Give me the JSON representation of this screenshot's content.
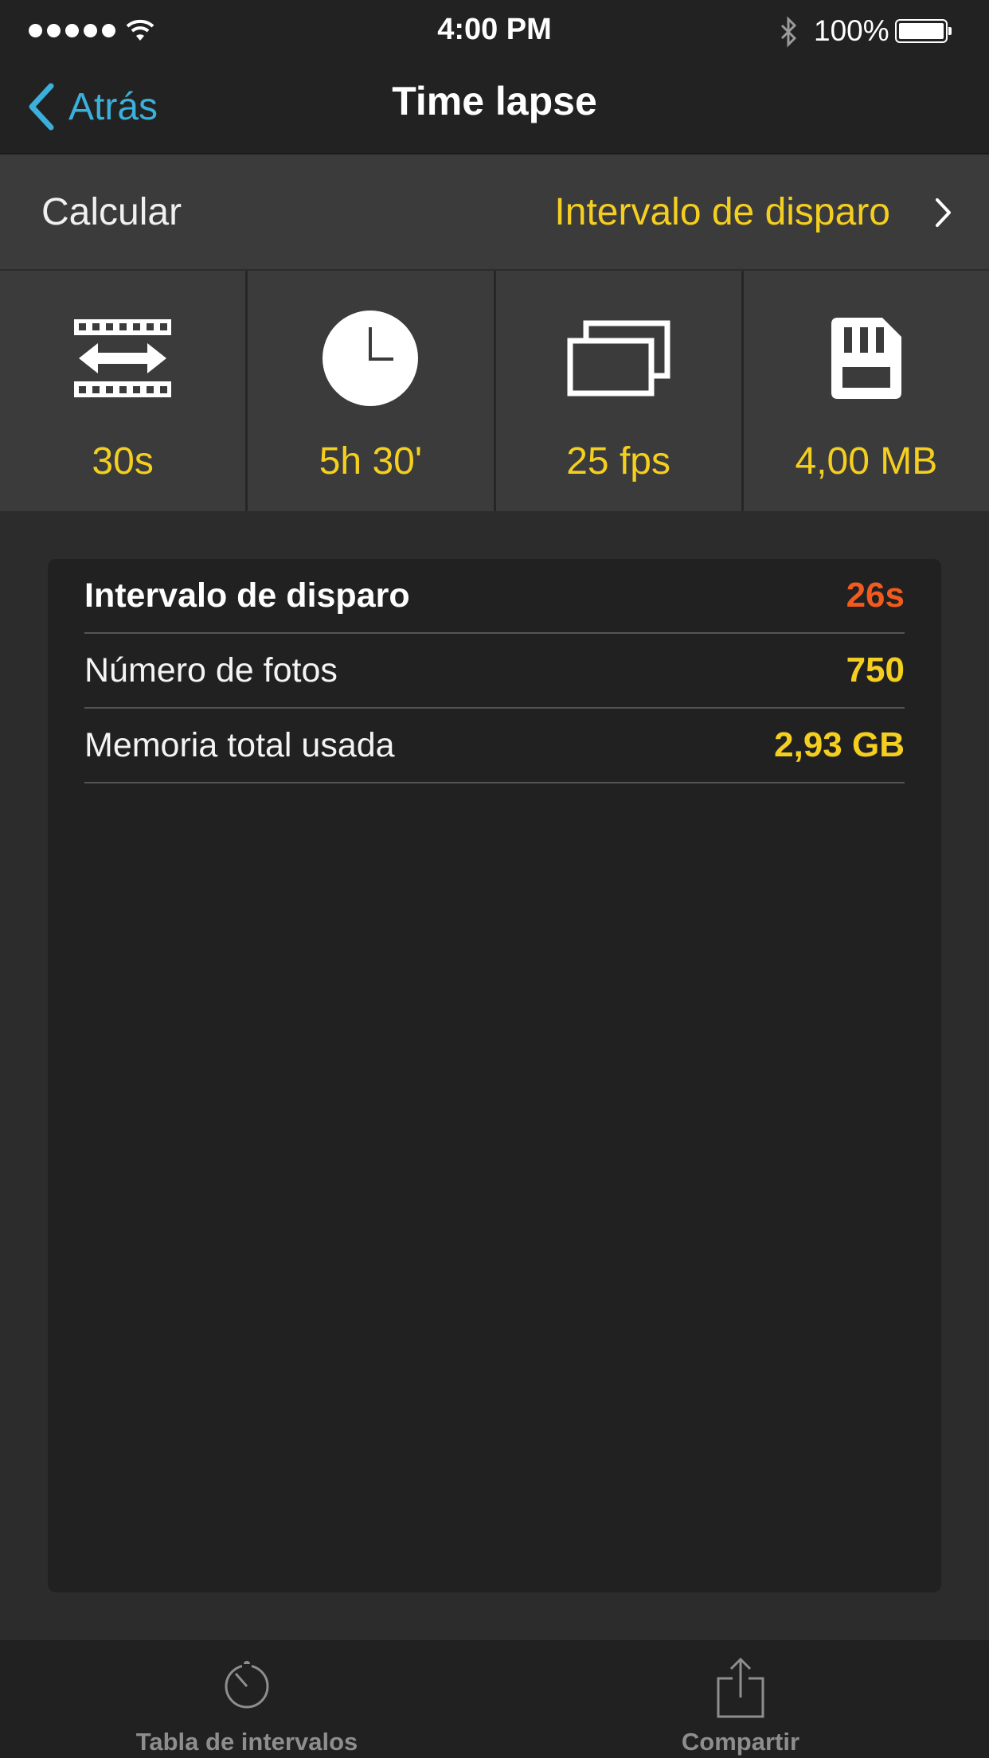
{
  "status_bar": {
    "time": "4:00 PM",
    "battery": "100%"
  },
  "nav": {
    "back_label": "Atrás",
    "title": "Time lapse"
  },
  "calculate": {
    "label": "Calcular",
    "value": "Intervalo de disparo"
  },
  "params": [
    {
      "icon": "film-interval-icon",
      "value": "30s"
    },
    {
      "icon": "clock-icon",
      "value": "5h 30'"
    },
    {
      "icon": "frames-icon",
      "value": "25 fps"
    },
    {
      "icon": "sd-card-icon",
      "value": "4,00 MB"
    }
  ],
  "results": [
    {
      "label": "Intervalo de disparo",
      "value": "26s"
    },
    {
      "label": "Número de fotos",
      "value": "750"
    },
    {
      "label": "Memoria total usada",
      "value": "2,93 GB"
    }
  ],
  "tabs": [
    {
      "icon": "timer-icon",
      "label": "Tabla de intervalos"
    },
    {
      "icon": "share-icon",
      "label": "Compartir"
    }
  ],
  "colors": {
    "accent_yellow": "#f5cf1f",
    "accent_orange": "#f25a1e",
    "link_blue": "#3bb0dc"
  }
}
